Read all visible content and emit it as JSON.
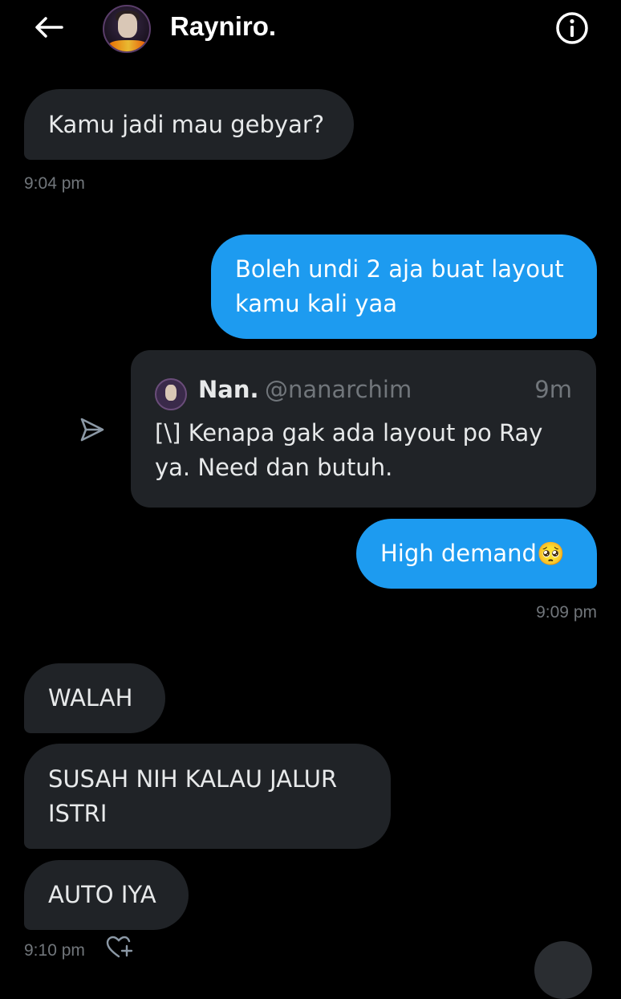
{
  "header": {
    "title": "Rayniro."
  },
  "messages": {
    "m1": {
      "text": "Kamu jadi mau gebyar?",
      "time": "9:04 pm"
    },
    "m2": {
      "line1": "Boleh undi 2 aja buat layout",
      "line2": "kamu kali yaa"
    },
    "quote": {
      "name": "Nan.",
      "handle": "@nanarchim",
      "time": "9m",
      "line1": "[\\] Kenapa gak ada layout po Ray",
      "line2": "ya. Need dan butuh."
    },
    "m3": {
      "text": "High demand",
      "emoji": "🥺",
      "time": "9:09 pm"
    },
    "m4": {
      "text": "WALAH"
    },
    "m5": {
      "line1": "SUSAH NIH KALAU JALUR",
      "line2": "ISTRI"
    },
    "m6": {
      "text": "AUTO IYA",
      "time": "9:10 pm"
    }
  },
  "icons": {
    "back": "arrow-left-icon",
    "info": "info-icon",
    "send": "send-icon",
    "react": "heart-plus-icon"
  },
  "colors": {
    "background": "#000000",
    "incoming_bubble": "#202327",
    "outgoing_bubble": "#1d9bf0",
    "muted_text": "#71767b"
  }
}
